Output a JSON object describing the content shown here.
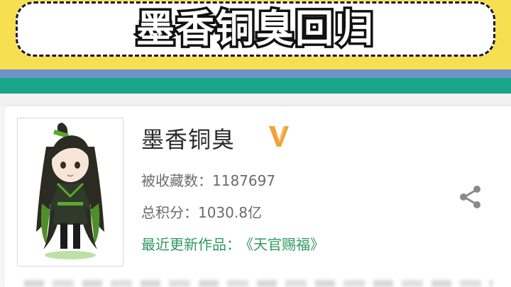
{
  "banner": {
    "title": "墨香铜臭回归"
  },
  "profile": {
    "name": "墨香铜臭",
    "verified_badge": "V",
    "favorites_label": "被收藏数：",
    "favorites_value": "1187697",
    "points_label": "总积分：",
    "points_value": "1030.8亿",
    "latest_label": "最近更新作品：",
    "latest_work": "《天官赐福》"
  },
  "icons": {
    "share": "share-icon",
    "badge": "verified-v-icon"
  },
  "colors": {
    "banner_yellow": "#f7df52",
    "stripe_green": "#18a58a",
    "stripe_blue": "#6f93c8",
    "link_green": "#2e9a5e",
    "badge_orange": "#f2a23a"
  }
}
